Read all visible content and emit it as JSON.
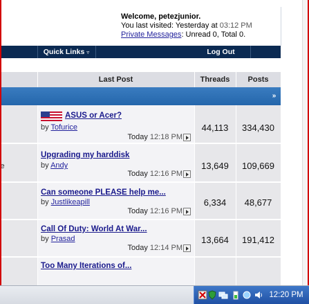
{
  "welcome": {
    "greeting": "Welcome, petezjunior.",
    "last_visited_label": "You last visited: Yesterday at",
    "last_visited_time": "03:12 PM",
    "pm_link": "Private Messages",
    "pm_status": ": Unread 0, Total 0."
  },
  "navbar": {
    "quick_links": "Quick Links",
    "logout": "Log Out"
  },
  "columns": {
    "last_post": "Last Post",
    "threads": "Threads",
    "posts": "Posts"
  },
  "clipped_text": {
    "row1": "r",
    "row2": "le"
  },
  "rows": [
    {
      "title": "ASUS or Acer?",
      "by": "by",
      "author": "Tofurice",
      "day": "Today",
      "time": "12:18 PM",
      "threads": "44,113",
      "posts": "334,430"
    },
    {
      "title": "Upgrading my harddisk",
      "by": "by",
      "author": "Andy",
      "day": "Today",
      "time": "12:16 PM",
      "threads": "13,649",
      "posts": "109,669"
    },
    {
      "title": "Can someone PLEASE help me...",
      "by": "by",
      "author": "Justlikeapill",
      "day": "Today",
      "time": "12:16 PM",
      "threads": "6,334",
      "posts": "48,677"
    },
    {
      "title": "Call Of Duty: World At War...",
      "by": "by",
      "author": "Prasad",
      "day": "Today",
      "time": "12:14 PM",
      "threads": "13,664",
      "posts": "191,412"
    },
    {
      "title": "Too Many Iterations of..."
    }
  ],
  "taskbar": {
    "clock": "12:20 PM"
  },
  "icons": {
    "thread_icon": "us-flag-icon",
    "goto": "go-to-last-post-icon",
    "collapse": "collapse-icon"
  },
  "colors": {
    "navbar": "#0b2a52",
    "category_band": "#2a6db3",
    "link": "#1a1a8c",
    "window_frame": "#d20000"
  }
}
